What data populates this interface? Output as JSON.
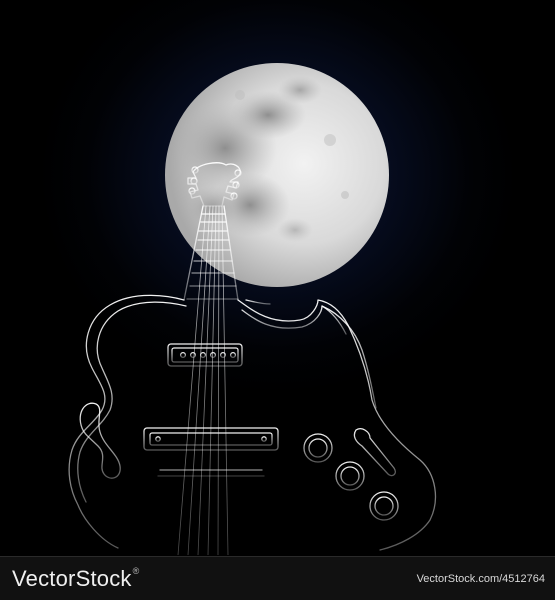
{
  "footer": {
    "brand": "VectorStock",
    "registered_mark": "®",
    "url": "VectorStock.com/4512764"
  },
  "colors": {
    "background": "#000000",
    "glow": "#0d1a3c",
    "moon": "#dcdcdc",
    "guitar_line": "#e6e6e6",
    "footer_bg": "#111111"
  }
}
